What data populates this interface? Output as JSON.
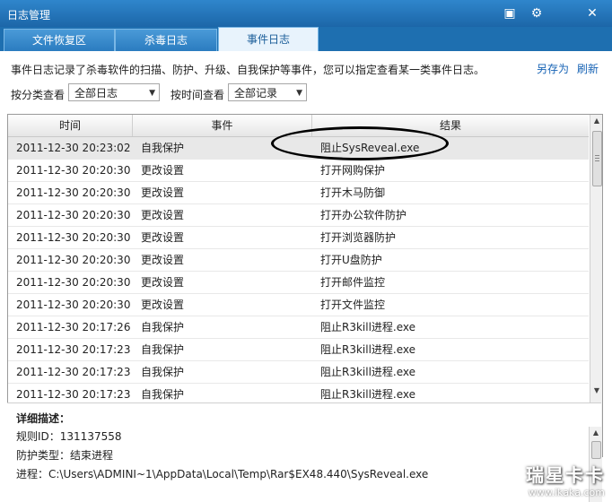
{
  "window": {
    "title": "日志管理",
    "buttons": {
      "menu": "▣",
      "settings": "⚙",
      "close": "✕"
    }
  },
  "tabs": [
    {
      "label": "文件恢复区",
      "active": false
    },
    {
      "label": "杀毒日志",
      "active": false
    },
    {
      "label": "事件日志",
      "active": true
    }
  ],
  "header": {
    "description": "事件日志记录了杀毒软件的扫描、防护、升级、自我保护等事件，您可以指定查看某一类事件日志。",
    "save_as": "另存为",
    "refresh": "刷新"
  },
  "filters": {
    "category_label": "按分类查看",
    "category_value": "全部日志",
    "time_label": "按时间查看",
    "time_value": "全部记录"
  },
  "table": {
    "columns": [
      "时间",
      "事件",
      "结果"
    ],
    "rows": [
      {
        "time": "2011-12-30 20:23:02",
        "event": "自我保护",
        "result": "阻止SysReveal.exe",
        "selected": true
      },
      {
        "time": "2011-12-30 20:20:30",
        "event": "更改设置",
        "result": "打开网购保护"
      },
      {
        "time": "2011-12-30 20:20:30",
        "event": "更改设置",
        "result": "打开木马防御"
      },
      {
        "time": "2011-12-30 20:20:30",
        "event": "更改设置",
        "result": "打开办公软件防护"
      },
      {
        "time": "2011-12-30 20:20:30",
        "event": "更改设置",
        "result": "打开浏览器防护"
      },
      {
        "time": "2011-12-30 20:20:30",
        "event": "更改设置",
        "result": "打开U盘防护"
      },
      {
        "time": "2011-12-30 20:20:30",
        "event": "更改设置",
        "result": "打开邮件监控"
      },
      {
        "time": "2011-12-30 20:20:30",
        "event": "更改设置",
        "result": "打开文件监控"
      },
      {
        "time": "2011-12-30 20:17:26",
        "event": "自我保护",
        "result": "阻止R3kill进程.exe"
      },
      {
        "time": "2011-12-30 20:17:23",
        "event": "自我保护",
        "result": "阻止R3kill进程.exe"
      },
      {
        "time": "2011-12-30 20:17:23",
        "event": "自我保护",
        "result": "阻止R3kill进程.exe"
      },
      {
        "time": "2011-12-30 20:17:23",
        "event": "自我保护",
        "result": "阻止R3kill进程.exe"
      }
    ]
  },
  "detail": {
    "title": "详细描述：",
    "rule_id": "规则ID：131137558",
    "protect_type": "防护类型：结束进程",
    "process": "进程：C:\\Users\\ADMINI~1\\AppData\\Local\\Temp\\Rar$EX48.440\\SysReveal.exe"
  },
  "watermark": {
    "brand": "瑞星卡卡",
    "url": "www.ikaka.com"
  },
  "colors": {
    "titlebar": "#1e6fb0",
    "link": "#1763b5",
    "selected_row": "#e8e8e8"
  }
}
